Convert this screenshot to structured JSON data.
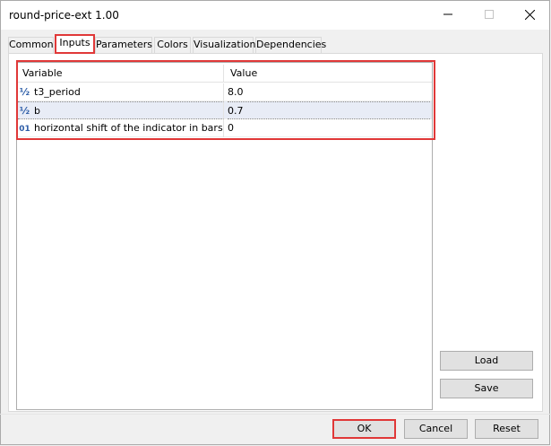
{
  "window": {
    "title": "round-price-ext 1.00",
    "controls": {
      "minimize_icon": "minimize-icon",
      "maximize_icon": "maximize-icon",
      "close_icon": "close-icon"
    }
  },
  "tabs": [
    {
      "label": "Common"
    },
    {
      "label": "Inputs",
      "active": true
    },
    {
      "label": "Parameters"
    },
    {
      "label": "Colors"
    },
    {
      "label": "Visualization"
    },
    {
      "label": "Dependencies"
    }
  ],
  "table": {
    "columns": [
      "Variable",
      "Value"
    ],
    "rows": [
      {
        "type_icon": "½",
        "icon_name": "double-type-icon",
        "variable": "t3_period",
        "value": "8.0"
      },
      {
        "type_icon": "½",
        "icon_name": "double-type-icon",
        "variable": "b",
        "value": "0.7"
      },
      {
        "type_icon": "01",
        "icon_name": "integer-type-icon",
        "variable": "horizontal shift of the indicator in bars",
        "value": "0"
      }
    ]
  },
  "side_buttons": {
    "load": "Load",
    "save": "Save"
  },
  "footer_buttons": {
    "ok": "OK",
    "cancel": "Cancel",
    "reset": "Reset"
  },
  "colors": {
    "highlight": "#e03838",
    "icon_blue": "#2e5ea8"
  }
}
